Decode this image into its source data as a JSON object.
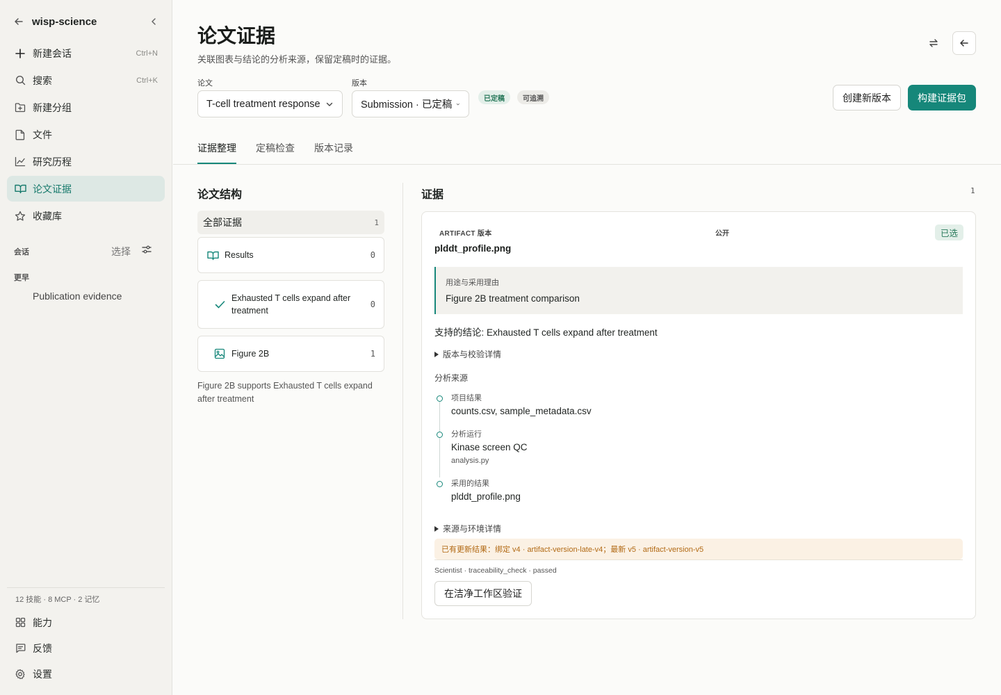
{
  "sidebar": {
    "workspace": "wisp-science",
    "nav": [
      {
        "label": "新建会话",
        "shortcut": "Ctrl+N"
      },
      {
        "label": "搜索",
        "shortcut": "Ctrl+K"
      },
      {
        "label": "新建分组",
        "shortcut": ""
      },
      {
        "label": "文件",
        "shortcut": ""
      },
      {
        "label": "研究历程",
        "shortcut": ""
      },
      {
        "label": "论文证据",
        "shortcut": ""
      },
      {
        "label": "收藏库",
        "shortcut": ""
      }
    ],
    "sessions_label": "会话",
    "select_label": "选择",
    "earlier_label": "更早",
    "sessions": [
      "Publication evidence"
    ],
    "stats": "12 技能 · 8 MCP · 2 记忆",
    "bottom": [
      {
        "label": "能力"
      },
      {
        "label": "反馈"
      },
      {
        "label": "设置"
      }
    ]
  },
  "header": {
    "title": "论文证据",
    "subtitle": "关联图表与结论的分析来源，保留定稿时的证据。",
    "paper_label": "论文",
    "paper_value": "T-cell treatment response",
    "version_label": "版本",
    "version_value": "Submission · 已定稿",
    "badges": [
      "已定稿",
      "可追溯"
    ],
    "create_version": "创建新版本",
    "build_package": "构建证据包"
  },
  "tabs": [
    "证据整理",
    "定稿检查",
    "版本记录"
  ],
  "structure": {
    "title": "论文结构",
    "all_label": "全部证据",
    "all_count": "1",
    "items": [
      {
        "label": "Results",
        "count": "0",
        "icon": "book-icon"
      },
      {
        "label": "Exhausted T cells expand after treatment",
        "count": "0",
        "icon": "check-icon"
      },
      {
        "label": "Figure 2B",
        "count": "1",
        "icon": "image-icon"
      }
    ],
    "note": "Figure 2B supports Exhausted T cells expand after treatment"
  },
  "evidence": {
    "title": "证据",
    "count": "1",
    "kind": "ARTIFACT 版本",
    "visibility": "公开",
    "selected": "已选",
    "name": "plddt_profile.png",
    "reason_title": "用途与采用理由",
    "reason_value": "Figure 2B treatment comparison",
    "claim": "支持的结论: Exhausted T cells expand after treatment",
    "version_details": "版本与校验详情",
    "source_title": "分析来源",
    "timeline": [
      {
        "label": "项目结果",
        "value": "counts.csv, sample_metadata.csv",
        "sub": ""
      },
      {
        "label": "分析运行",
        "value": "Kinase screen QC",
        "sub": "analysis.py"
      },
      {
        "label": "采用的结果",
        "value": "plddt_profile.png",
        "sub": ""
      }
    ],
    "env_details": "来源与环境详情",
    "warning": "已有更新结果：绑定 v4 · artifact-version-late-v4；最新 v5 · artifact-version-v5",
    "audit": "Scientist · traceability_check · passed",
    "verify": "在洁净工作区验证"
  },
  "colors": {
    "accent": "#16877a",
    "warning": "#b26a15"
  }
}
